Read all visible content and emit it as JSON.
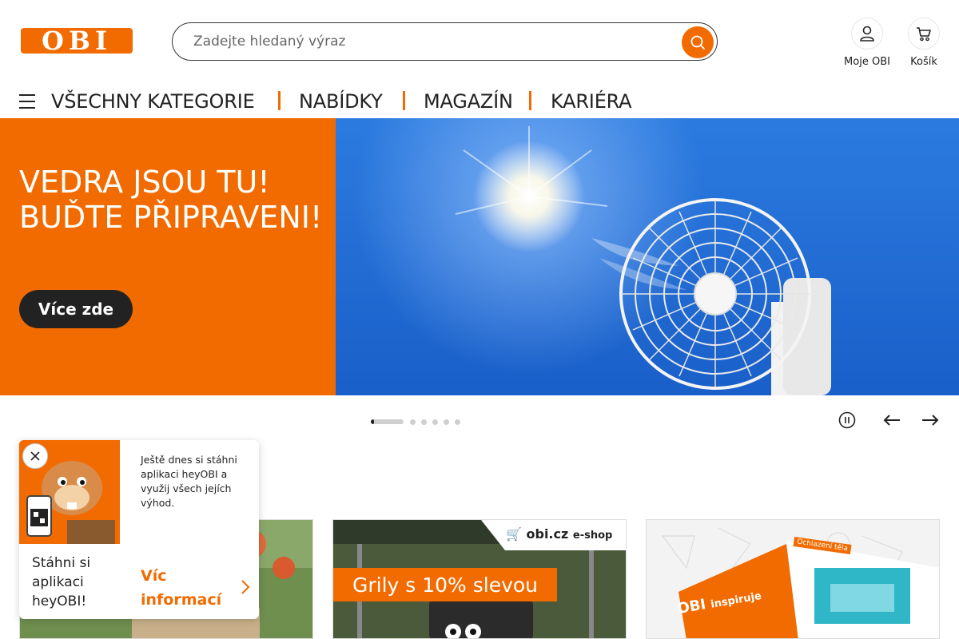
{
  "header": {
    "logo_text": "OBI",
    "search_placeholder": "Zadejte hledaný výraz",
    "account_label": "Moje OBI",
    "cart_label": "Košík"
  },
  "nav": {
    "items": [
      {
        "label": "VŠECHNY KATEGORIE"
      },
      {
        "label": "NABÍDKY"
      },
      {
        "label": "MAGAZÍN"
      },
      {
        "label": "KARIÉRA"
      }
    ]
  },
  "hero": {
    "title": "VEDRA JSOU TU! BUĎTE PŘIPRAVENI!",
    "button_label": "Více zde"
  },
  "carousel": {
    "slide_count": 6,
    "active_index": 0
  },
  "cards": [
    {
      "caption": ""
    },
    {
      "badge_site": "obi.cz",
      "badge_label": "e-shop",
      "caption": "Grily s 10% slevou"
    },
    {
      "brochure_brand": "OBI",
      "brochure_title": "inspiruje",
      "brochure_tag": "Ochlazení těla"
    }
  ],
  "app_popup": {
    "text": "Ještě dnes si stáhni aplikaci heyOBI a využij všech jejích výhod.",
    "cta": "Stáhni si aplikaci heyOBI!",
    "more": "Víc informací"
  },
  "colors": {
    "brand_orange": "#f26b00",
    "dark": "#222222"
  }
}
